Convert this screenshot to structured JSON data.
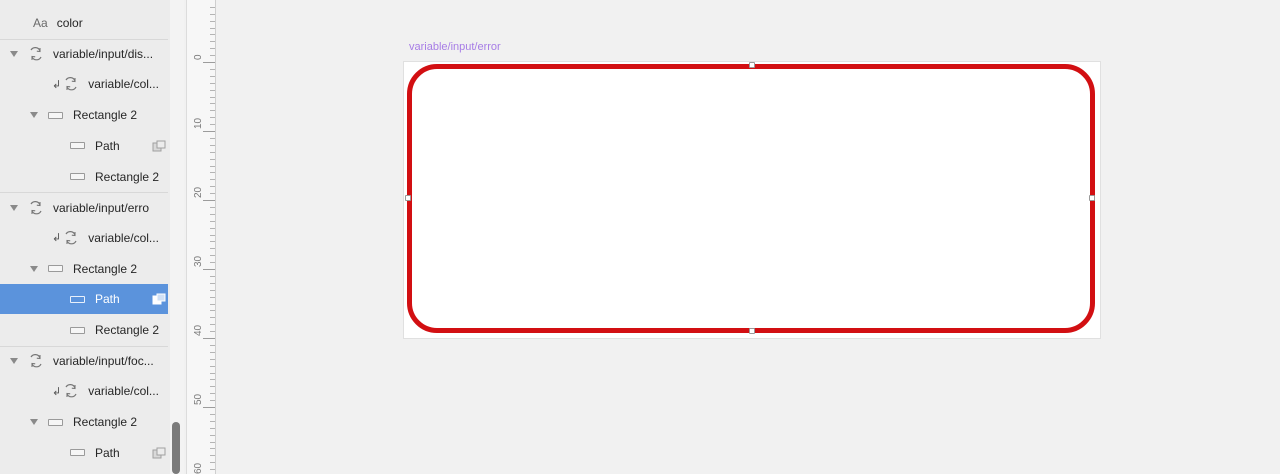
{
  "layers": [
    {
      "label": "color",
      "kind": "text",
      "indent": 0,
      "expanded": false
    },
    {
      "label": "variable/input/dis...",
      "kind": "symbol",
      "indent": 0,
      "expanded": true,
      "group": true
    },
    {
      "label": "variable/col...",
      "kind": "symbol-override",
      "indent": 2
    },
    {
      "label": "Rectangle 2",
      "kind": "shape-group",
      "indent": 1,
      "expanded": true
    },
    {
      "label": "Path",
      "kind": "path",
      "indent": 2,
      "mask": true
    },
    {
      "label": "Rectangle 2",
      "kind": "path",
      "indent": 2
    },
    {
      "label": "variable/input/erro",
      "kind": "symbol",
      "indent": 0,
      "expanded": true,
      "group": true
    },
    {
      "label": "variable/col...",
      "kind": "symbol-override",
      "indent": 2
    },
    {
      "label": "Rectangle 2",
      "kind": "shape-group",
      "indent": 1,
      "expanded": true
    },
    {
      "label": "Path",
      "kind": "path",
      "indent": 2,
      "mask": true,
      "selected": true
    },
    {
      "label": "Rectangle 2",
      "kind": "path",
      "indent": 2
    },
    {
      "label": "variable/input/foc...",
      "kind": "symbol",
      "indent": 0,
      "expanded": true,
      "group": true
    },
    {
      "label": "variable/col...",
      "kind": "symbol-override",
      "indent": 2
    },
    {
      "label": "Rectangle 2",
      "kind": "shape-group",
      "indent": 1,
      "expanded": true
    },
    {
      "label": "Path",
      "kind": "path",
      "indent": 2,
      "mask": true
    }
  ],
  "text_icon_glyph": "Aa",
  "ruler": {
    "labels": [
      "0",
      "10",
      "20",
      "30",
      "40",
      "50",
      "60"
    ]
  },
  "canvas": {
    "artboard_title": "variable/input/error",
    "stroke_color": "#d20f12",
    "selection_color": "#5b93dc",
    "artboard_title_color": "#a77de6"
  }
}
